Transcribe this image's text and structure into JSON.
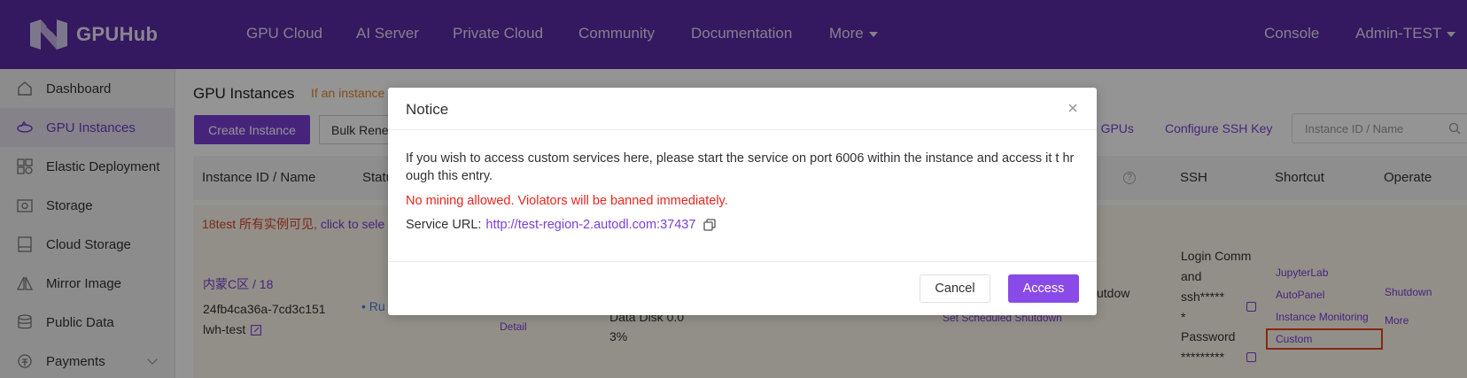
{
  "brand": {
    "name": "GPUHub"
  },
  "nav": {
    "items": [
      "GPU Cloud",
      "AI Server",
      "Private Cloud",
      "Community",
      "Documentation",
      "More"
    ],
    "console": "Console",
    "user": "Admin-TEST"
  },
  "sidebar": {
    "items": [
      {
        "label": "Dashboard",
        "icon": "home-icon"
      },
      {
        "label": "GPU Instances",
        "icon": "gpu-icon"
      },
      {
        "label": "Elastic Deployment",
        "icon": "grid-icon"
      },
      {
        "label": "Storage",
        "icon": "storage-icon"
      },
      {
        "label": "Cloud Storage",
        "icon": "cloud-storage-icon"
      },
      {
        "label": "Mirror Image",
        "icon": "mirror-icon"
      },
      {
        "label": "Public Data",
        "icon": "database-icon"
      },
      {
        "label": "Payments",
        "icon": "payments-icon"
      }
    ]
  },
  "main": {
    "title": "GPU Instances",
    "warning": "If an instance",
    "create_button": "Create Instance",
    "bulk_button": "Bulk Rene",
    "idle_gpus_link": "dle GPUs",
    "ssh_key_link": "Configure SSH Key",
    "search_placeholder": "Instance ID / Name",
    "columns": [
      "Instance ID / Name",
      "Statu",
      "SSH",
      "Shortcut",
      "Operate"
    ],
    "group_text": "18test 所有实例可见,",
    "group_link": "click to sele",
    "row": {
      "region": "内蒙C区 / 18",
      "instance_id": "24fb4ca36a-7cd3c151",
      "name": "lwh-test",
      "status": "• Ru",
      "detail": "Detail",
      "data_disk": "Data Disk 0.0",
      "data_disk_pct": "3%",
      "shutdown_partial": "utdow",
      "scheduled_shutdown": "Set Scheduled Shutdown",
      "ssh_line1": "Login Comm",
      "ssh_line2": "and",
      "ssh_line3": "ssh*****",
      "ssh_line4": "*",
      "ssh_line5": "Password",
      "ssh_line6": "*********",
      "shortcuts": [
        "JupyterLab",
        "AutoPanel",
        "Instance Monitoring",
        "Custom"
      ],
      "operate": [
        "Shutdown",
        "More"
      ]
    }
  },
  "dialog": {
    "title": "Notice",
    "description": "If you wish to access custom services here, please start the service on port 6006 within the instance and access it t hrough this entry.",
    "warning": "No mining allowed. Violators will be banned immediately.",
    "url_label": "Service URL:",
    "url": "http://test-region-2.autodl.com:37437",
    "cancel": "Cancel",
    "access": "Access"
  },
  "colors": {
    "topbar": "#5b2aa6",
    "accent": "#7b3fd6",
    "warning_red": "#e8251d",
    "highlight_box": "#e8421f"
  }
}
